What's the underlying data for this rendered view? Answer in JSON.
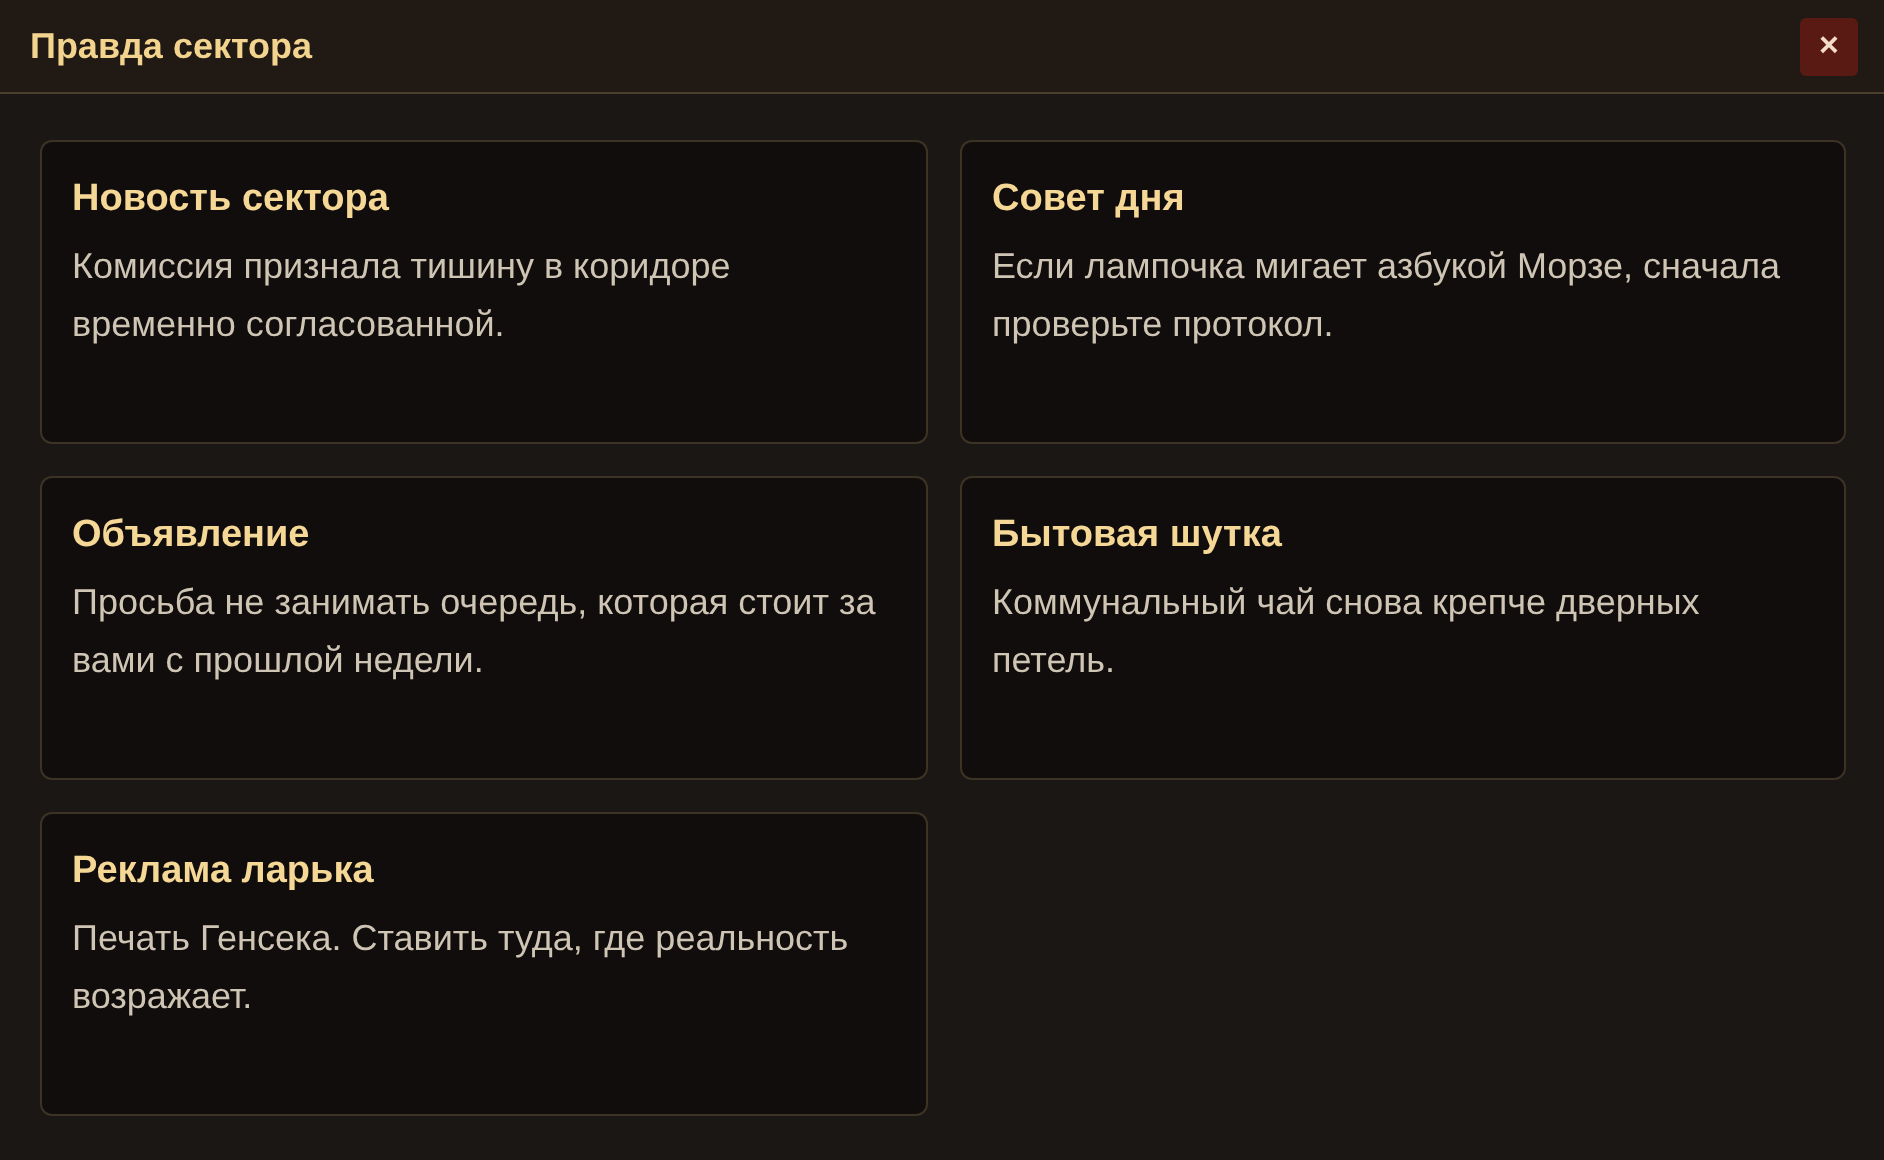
{
  "window": {
    "title": "Правда сектора",
    "close": "×"
  },
  "cards": [
    {
      "title": "Новость сектора",
      "text": "Комиссия признала тишину в коридоре временно согласованной."
    },
    {
      "title": "Совет дня",
      "text": "Если лампочка мигает азбукой Морзе, сначала проверьте протокол."
    },
    {
      "title": "Объявление",
      "text": "Просьба не занимать очередь, которая стоит за вами с прошлой недели."
    },
    {
      "title": "Бытовая шутка",
      "text": "Коммунальный чай снова крепче дверных петель."
    },
    {
      "title": "Реклама ларька",
      "text": "Печать Генсека. Ставить туда, где реальность возражает."
    }
  ]
}
